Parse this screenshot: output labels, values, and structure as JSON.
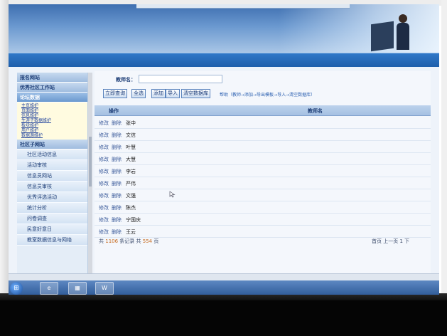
{
  "search": {
    "label": "教师名：",
    "value": ""
  },
  "toolbar": {
    "buttons": [
      "立即查询",
      "全选",
      "添加",
      "导入",
      "清空数据库"
    ],
    "hint": "帮助（教师→添加→导出模板→导入→清空数据库）"
  },
  "sidebar": {
    "sections": [
      "报名网站",
      "优秀社区工作站",
      "论坛数据"
    ],
    "subitems": [
      "主页维护",
      "页面维护",
      "信息维护",
      "生涯子数据维护",
      "板块维护",
      "用户维护",
      "数据源维护"
    ],
    "community_section": "社区子网站",
    "items": [
      "社区活动信息",
      "活动审核",
      "信息员网站",
      "信息员审核",
      "优秀评选活动",
      "统计分析",
      "问卷调查",
      "民意好意日",
      "教室数据信息与网络"
    ]
  },
  "table": {
    "headers": {
      "op": "操作",
      "name": "教师名"
    },
    "edit_label": "修改",
    "delete_label": "删除",
    "rows": [
      "张中",
      "文信",
      "叶慧",
      "大慧",
      "李岩",
      "严伟",
      "文强",
      "陈杰",
      "宁国庆",
      "王云"
    ]
  },
  "pager": {
    "total_prefix": "共",
    "total_value": "1106",
    "total_suffix": "条记录",
    "pages_prefix": "共",
    "pages_value": "554",
    "pages_suffix": "页",
    "nav": "首页 上一页 1 下"
  },
  "taskbar": {
    "start_icon": "windows-orb",
    "apps": [
      "e",
      "▦",
      "W"
    ]
  },
  "colors": {
    "banner": "#3e6fb0",
    "navbar": "#1f5fab",
    "accent_link": "#2a4aa0",
    "count_orange": "#c76b1e"
  }
}
